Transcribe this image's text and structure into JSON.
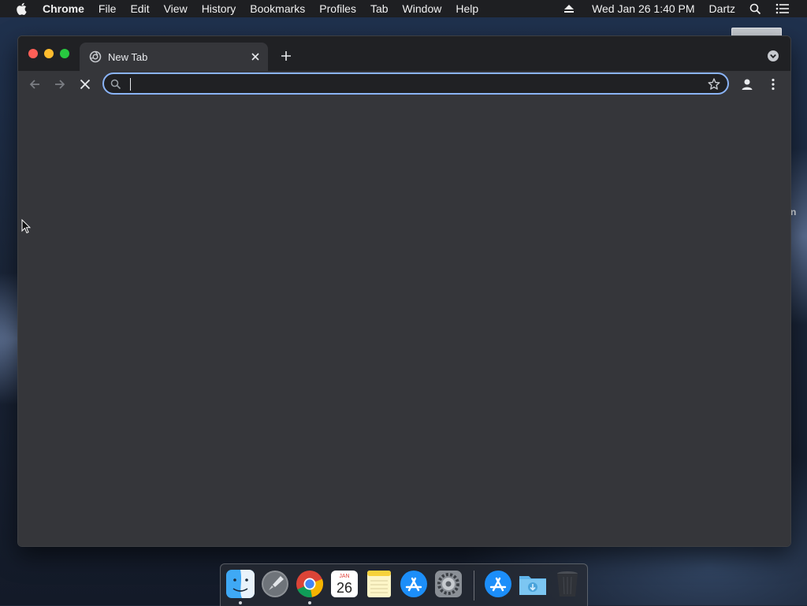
{
  "menubar": {
    "app_name": "Chrome",
    "menus": [
      "File",
      "Edit",
      "View",
      "History",
      "Bookmarks",
      "Profiles",
      "Tab",
      "Window",
      "Help"
    ],
    "datetime": "Wed Jan 26  1:40 PM",
    "user": "Dartz",
    "icons": [
      "apple-icon",
      "eject-icon",
      "spotlight-icon",
      "notification-center-icon"
    ]
  },
  "browser": {
    "tab_title": "New Tab",
    "omnibox_value": "",
    "icons": [
      "new-tab-favicon",
      "close-tab-icon",
      "new-tab-plus-icon",
      "tab-search-icon",
      "back-icon",
      "forward-icon",
      "stop-loading-icon",
      "search-icon",
      "bookmark-star-icon",
      "profile-icon",
      "more-menu-icon"
    ],
    "colors": {
      "frame": "#202124",
      "toolbar": "#35363a",
      "focus_ring": "#8ab4f8"
    }
  },
  "desktop": {
    "partial_text": "n"
  },
  "dock": {
    "apps": [
      "Finder",
      "Launchpad",
      "Google Chrome",
      "Calendar",
      "Notes",
      "App Store",
      "System Preferences",
      "App Store",
      "Downloads",
      "Trash"
    ],
    "calendar_month": "JAN",
    "calendar_day": "26"
  }
}
